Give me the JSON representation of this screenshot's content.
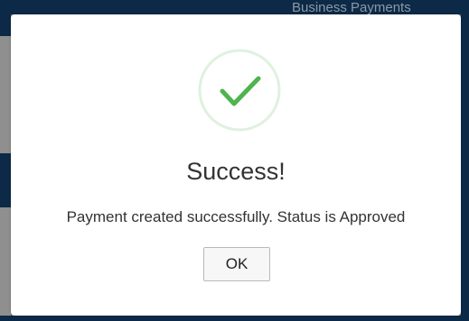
{
  "background": {
    "header_text": "Business Payments"
  },
  "dialog": {
    "icon": "checkmark-icon",
    "title": "Success!",
    "message": "Payment created successfully. Status is Approved",
    "ok_label": "OK"
  },
  "colors": {
    "success_green": "#4fb44f",
    "success_ring": "#dff1df",
    "header_navy": "#0c2a47"
  }
}
